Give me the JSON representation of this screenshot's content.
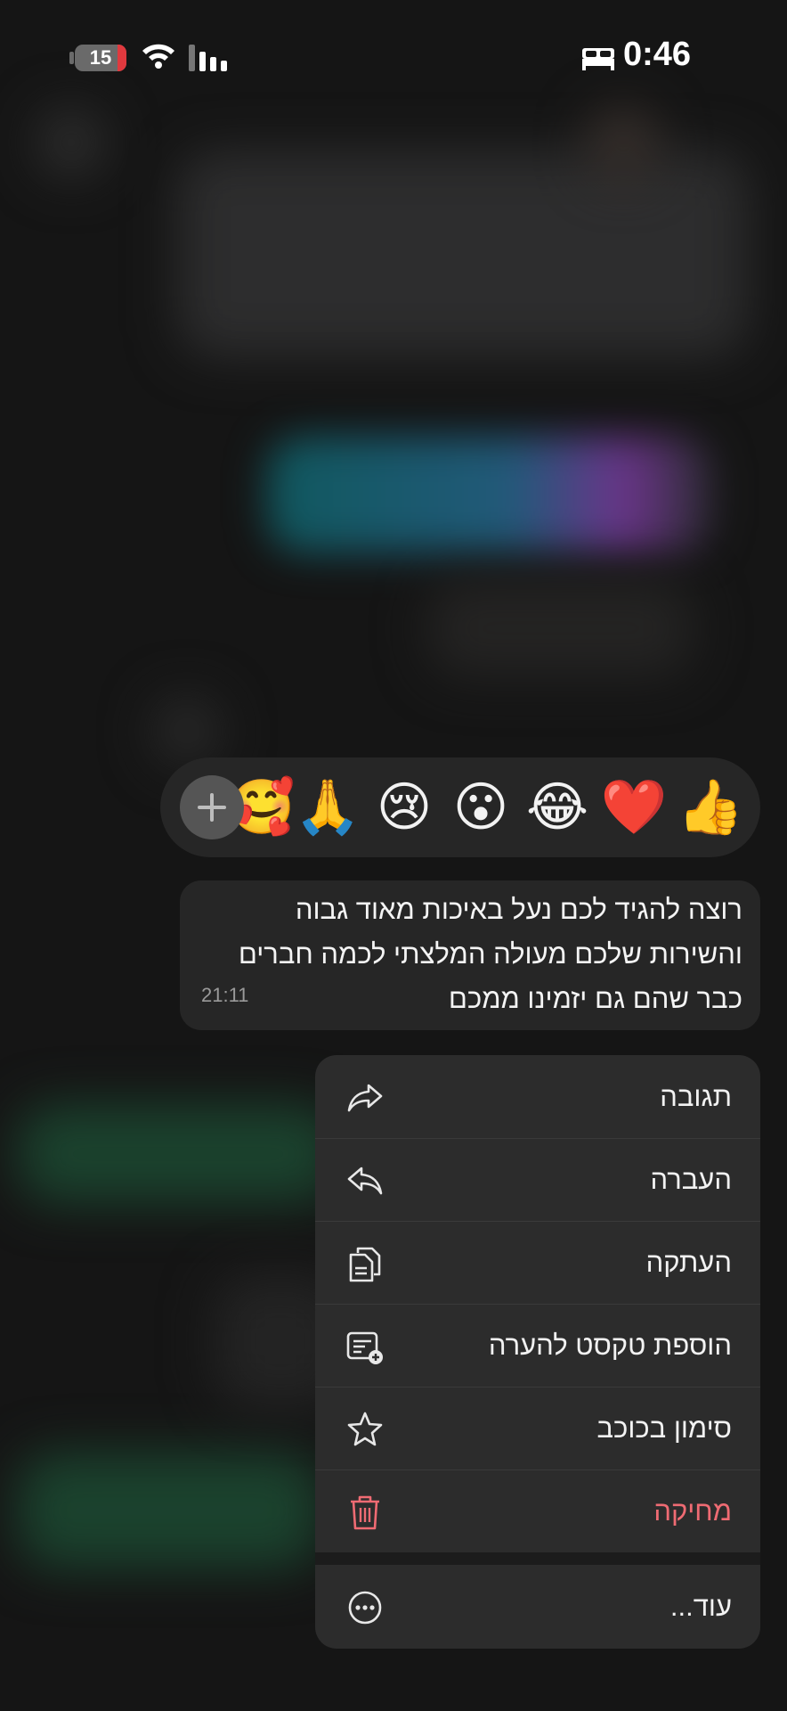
{
  "status_bar": {
    "battery_level": "15",
    "time": "0:46"
  },
  "reactions": {
    "emojis": [
      "👍",
      "❤️",
      "😂",
      "😮",
      "😢",
      "🙏",
      "🥰"
    ],
    "add_icon": "plus-icon"
  },
  "message": {
    "lines": [
      "רוצה להגיד לכם נעל באיכות מאוד גבוה",
      "והשירות שלכם מעולה המלצתי לכמה חברים",
      "כבר שהם גם יזמינו ממכם"
    ],
    "time": "21:11"
  },
  "menu": {
    "reply": {
      "label": "תגובה",
      "icon": "reply-arrow-icon"
    },
    "forward": {
      "label": "העברה",
      "icon": "forward-arrow-icon"
    },
    "copy": {
      "label": "העתקה",
      "icon": "copy-icon"
    },
    "add_note": {
      "label": "הוספת טקסט להערה",
      "icon": "note-add-icon"
    },
    "star": {
      "label": "סימון בכוכב",
      "icon": "star-icon"
    },
    "delete": {
      "label": "מחיקה",
      "icon": "trash-icon",
      "color": "#ef6b73"
    },
    "more": {
      "label": "עוד...",
      "icon": "more-icon"
    }
  }
}
